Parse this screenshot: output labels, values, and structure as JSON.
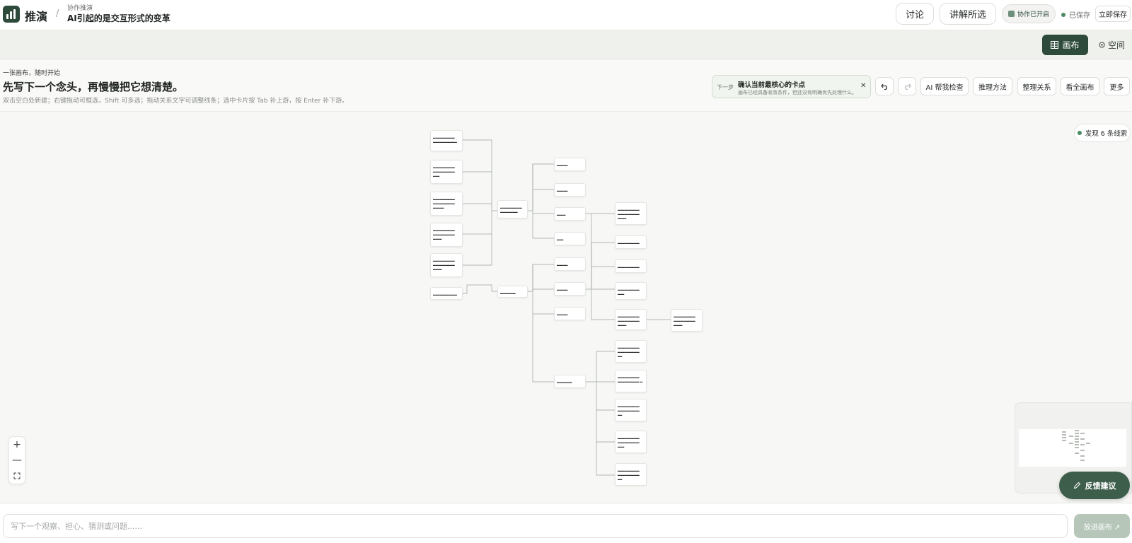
{
  "app": {
    "brand": "推演",
    "breadcrumb_sub": "协作推演",
    "breadcrumb_title": "AI引起的是交互形式的变革"
  },
  "header_actions": {
    "discuss_label": "讨论",
    "explain_label": "讲解所选",
    "collab_label": "协作已开启",
    "saved_label": "已保存",
    "save_now_label": "立即保存"
  },
  "views": {
    "canvas_label": "画布",
    "space_label": "空间"
  },
  "intro": {
    "eyebrow": "一张画布，随时开始",
    "headline": "先写下一个念头，再慢慢把它想清楚。",
    "hint": "双击空白处新建；右键拖动可框选，Shift 可多选；拖动关系文字可调整线条；选中卡片按 Tab 补上游，按 Enter 补下游。"
  },
  "next_step": {
    "label": "下一步",
    "title": "确认当前最核心的卡点",
    "desc": "画布已经具备收敛条件，但还没有明确优先处理什么。"
  },
  "toolbar": {
    "ai_check": "AI 帮我检查",
    "reasoning": "推理方法",
    "organize": "整理关系",
    "view_all": "看全画布",
    "more": "更多"
  },
  "clues_label": "发现 6 条线索",
  "feedback_label": "反馈建议",
  "composer": {
    "placeholder": "写下一个观察、担心、猜测或问题......",
    "send_label": "放进画布 ↗"
  },
  "colors": {
    "brand": "#2d4a3b",
    "accent": "#4b8a63"
  },
  "icons": [
    "logo-bars-icon",
    "collab-icon",
    "grid-icon",
    "target-icon",
    "undo-icon",
    "redo-icon",
    "close-icon",
    "zoom-in-icon",
    "zoom-out-icon",
    "fit-icon",
    "pencil-icon"
  ]
}
